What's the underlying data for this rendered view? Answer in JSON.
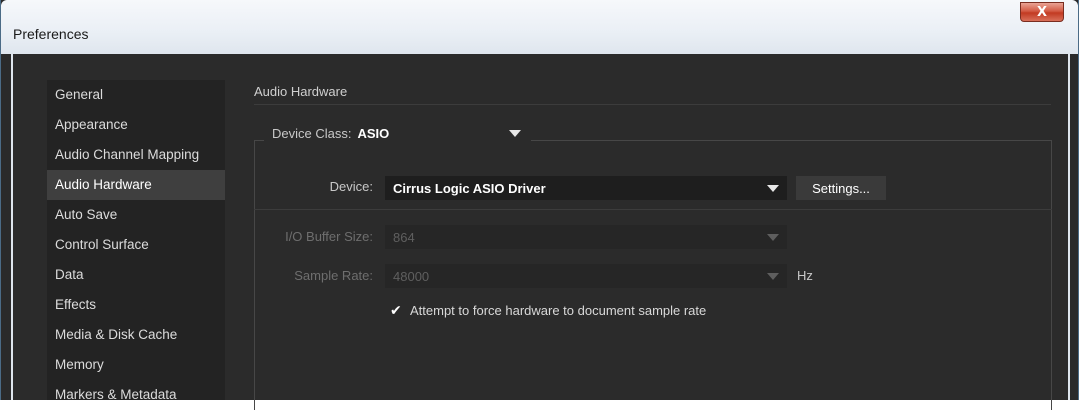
{
  "window": {
    "title": "Preferences",
    "close_glyph": "X"
  },
  "sidebar": {
    "items": [
      {
        "label": "General"
      },
      {
        "label": "Appearance"
      },
      {
        "label": "Audio Channel Mapping"
      },
      {
        "label": "Audio Hardware"
      },
      {
        "label": "Auto Save"
      },
      {
        "label": "Control Surface"
      },
      {
        "label": "Data"
      },
      {
        "label": "Effects"
      },
      {
        "label": "Media & Disk Cache"
      },
      {
        "label": "Memory"
      },
      {
        "label": "Markers & Metadata"
      }
    ],
    "selected": "Audio Hardware"
  },
  "panel": {
    "title": "Audio Hardware",
    "device_class_label": "Device Class:",
    "device_class_value": "ASIO",
    "device_label": "Device:",
    "device_value": "Cirrus Logic ASIO Driver",
    "settings_button": "Settings...",
    "buffer_label": "I/O Buffer Size:",
    "buffer_value": "864",
    "sample_rate_label": "Sample Rate:",
    "sample_rate_value": "48000",
    "sample_rate_unit": "Hz",
    "force_rate_label": "Attempt to force hardware to document sample rate",
    "force_rate_checked": true,
    "check_glyph": "✔"
  },
  "colors": {
    "panel_bg": "#2b2b2b",
    "sidebar_bg": "#232323",
    "selected_item_bg": "#3f3f3f",
    "close_button": "#c23a22"
  },
  "icons": [
    "close-icon",
    "dropdown-arrow-icon",
    "checkmark-icon"
  ]
}
